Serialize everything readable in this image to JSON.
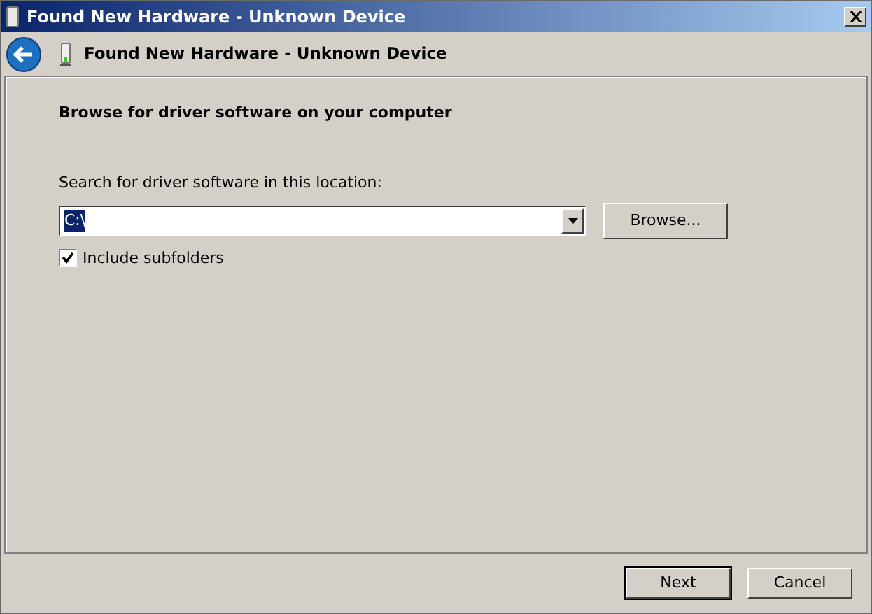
{
  "window": {
    "title": "Found New Hardware - Unknown Device"
  },
  "header": {
    "title": "Found New Hardware - Unknown Device"
  },
  "heading": "Browse for driver software on your computer",
  "location": {
    "label": "Search for driver software in this location:",
    "value": "C:\\",
    "text_selected": true
  },
  "browse_button": "Browse...",
  "include_subfolders": {
    "label": "Include subfolders",
    "checked": true
  },
  "buttons": [
    {
      "label": "Next",
      "default": true
    },
    {
      "label": "Cancel",
      "default": false
    }
  ]
}
